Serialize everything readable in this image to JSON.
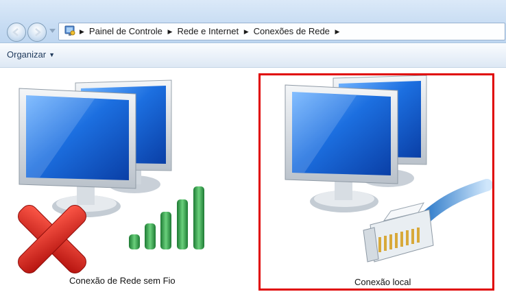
{
  "address": {
    "breadcrumbs": [
      "Painel de Controle",
      "Rede e Internet",
      "Conexões de Rede"
    ]
  },
  "toolbar": {
    "organize_label": "Organizar"
  },
  "connections": [
    {
      "label": "Conexão de Rede sem Fio",
      "icon": "wireless-network-icon",
      "status": "disconnected",
      "signal_bars": 5
    },
    {
      "label": "Conexão local",
      "icon": "local-area-connection-icon",
      "selected": true
    }
  ],
  "colors": {
    "highlight_border": "#e00000",
    "signal_bar": "#2fa046",
    "error_x": "#d9201c"
  }
}
